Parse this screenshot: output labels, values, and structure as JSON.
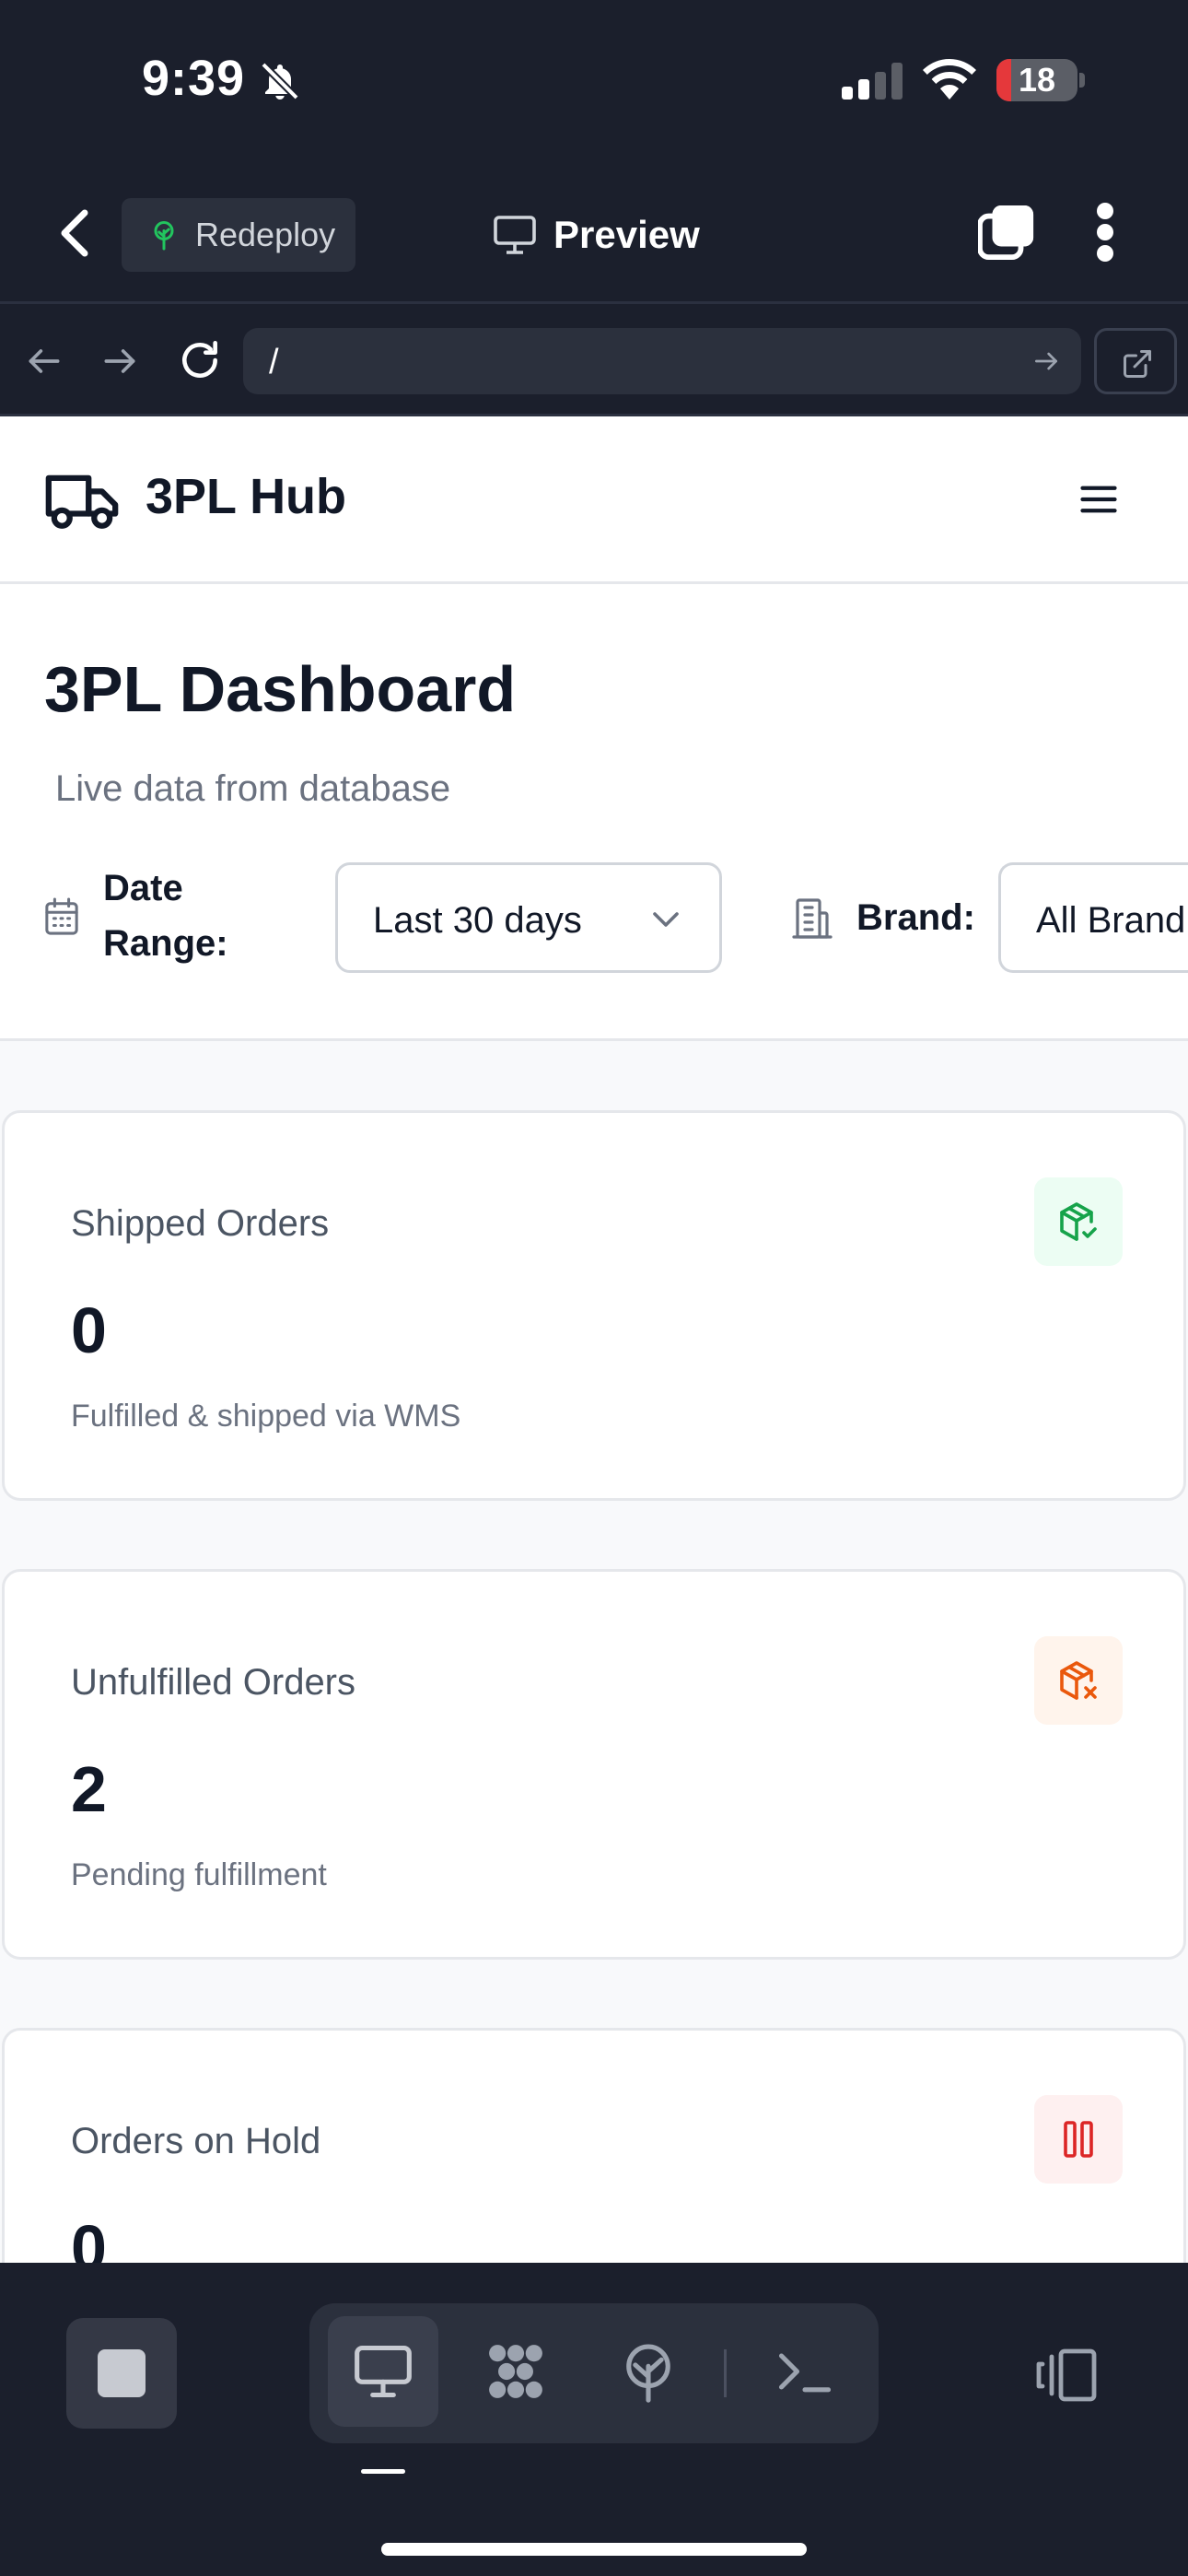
{
  "status_bar": {
    "time": "9:39",
    "battery_level": "18",
    "battery_fraction": 0.18
  },
  "app_bar": {
    "redeploy_label": "Redeploy",
    "preview_label": "Preview"
  },
  "url_bar": {
    "url": "/"
  },
  "site": {
    "brand": "3PL Hub"
  },
  "dashboard": {
    "title": "3PL Dashboard",
    "subtitle": "Live data from database",
    "date_range_label": "Date Range:",
    "date_range_value": "Last 30 days",
    "brand_label": "Brand:",
    "brand_value": "All Brand"
  },
  "cards": [
    {
      "title": "Shipped Orders",
      "value": "0",
      "description": "Fulfilled & shipped via WMS",
      "icon": "package-check-icon",
      "color": "#16a34a",
      "bg": "#ecfdf3"
    },
    {
      "title": "Unfulfilled Orders",
      "value": "2",
      "description": "Pending fulfillment",
      "icon": "package-x-icon",
      "color": "#ea580c",
      "bg": "#fff4ec"
    },
    {
      "title": "Orders on Hold",
      "value": "0",
      "description": "",
      "icon": "pause-icon",
      "color": "#dc2626",
      "bg": "#fef0f0"
    }
  ],
  "colors": {
    "chrome_bg": "#1b1f2c",
    "chrome_surface": "#2b303d",
    "page_bg": "#f8f9fb"
  }
}
